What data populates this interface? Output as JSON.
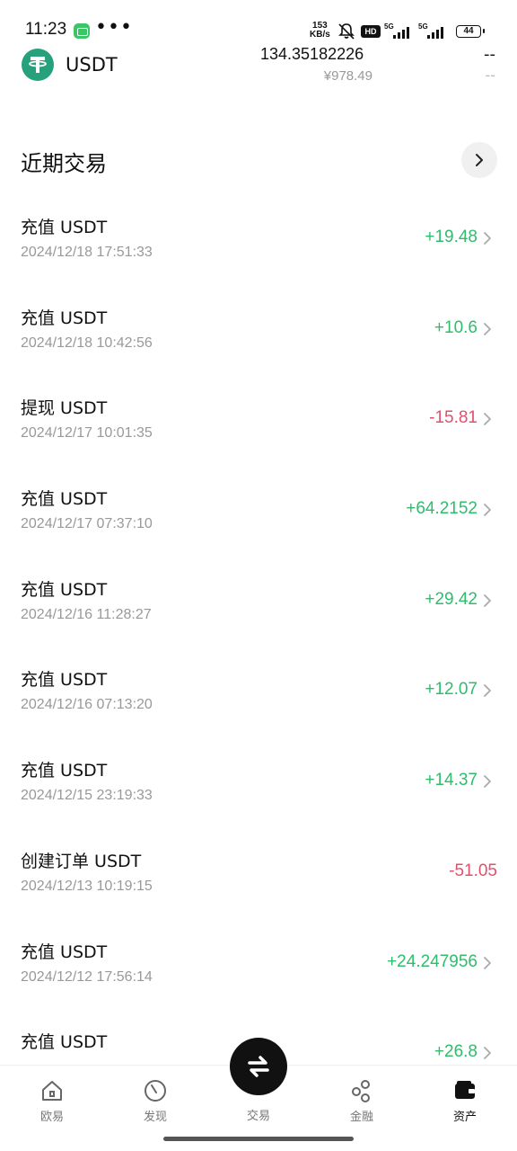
{
  "status_bar": {
    "time": "11:23",
    "speed_top": "153",
    "speed_unit": "KB/s",
    "hd_label": "HD",
    "sig1_label": "5G",
    "sig2_label": "5G",
    "battery": "44"
  },
  "asset": {
    "name": "USDT",
    "amount": "134.35182226",
    "cny_value": "¥978.49",
    "change_top": "--",
    "change_bottom": "--"
  },
  "recent": {
    "title": "近期交易"
  },
  "transactions": [
    {
      "title": "充值 USDT",
      "time": "2024/12/18 17:51:33",
      "amount": "+19.48",
      "direction": "pos",
      "chevron": true
    },
    {
      "title": "充值 USDT",
      "time": "2024/12/18 10:42:56",
      "amount": "+10.6",
      "direction": "pos",
      "chevron": true
    },
    {
      "title": "提现 USDT",
      "time": "2024/12/17 10:01:35",
      "amount": "-15.81",
      "direction": "neg",
      "chevron": true
    },
    {
      "title": "充值 USDT",
      "time": "2024/12/17 07:37:10",
      "amount": "+64.2152",
      "direction": "pos",
      "chevron": true
    },
    {
      "title": "充值 USDT",
      "time": "2024/12/16 11:28:27",
      "amount": "+29.42",
      "direction": "pos",
      "chevron": true
    },
    {
      "title": "充值 USDT",
      "time": "2024/12/16 07:13:20",
      "amount": "+12.07",
      "direction": "pos",
      "chevron": true
    },
    {
      "title": "充值 USDT",
      "time": "2024/12/15 23:19:33",
      "amount": "+14.37",
      "direction": "pos",
      "chevron": true
    },
    {
      "title": "创建订单 USDT",
      "time": "2024/12/13 10:19:15",
      "amount": "-51.05",
      "direction": "neg",
      "chevron": false
    },
    {
      "title": "充值 USDT",
      "time": "2024/12/12 17:56:14",
      "amount": "+24.247956",
      "direction": "pos",
      "chevron": true
    },
    {
      "title": "充值 USDT",
      "time": "",
      "amount": "+26.8",
      "direction": "pos",
      "chevron": true
    }
  ],
  "nav": {
    "items": [
      {
        "label": "欧易",
        "icon": "home-icon"
      },
      {
        "label": "发现",
        "icon": "discover-icon"
      },
      {
        "label": "交易",
        "icon": "swap-icon"
      },
      {
        "label": "金融",
        "icon": "finance-icon"
      },
      {
        "label": "资产",
        "icon": "wallet-icon"
      }
    ],
    "active": "资产"
  },
  "colors": {
    "positive": "#2fbd6c",
    "negative": "#e2506c",
    "usdt_brand": "#26a17b"
  }
}
